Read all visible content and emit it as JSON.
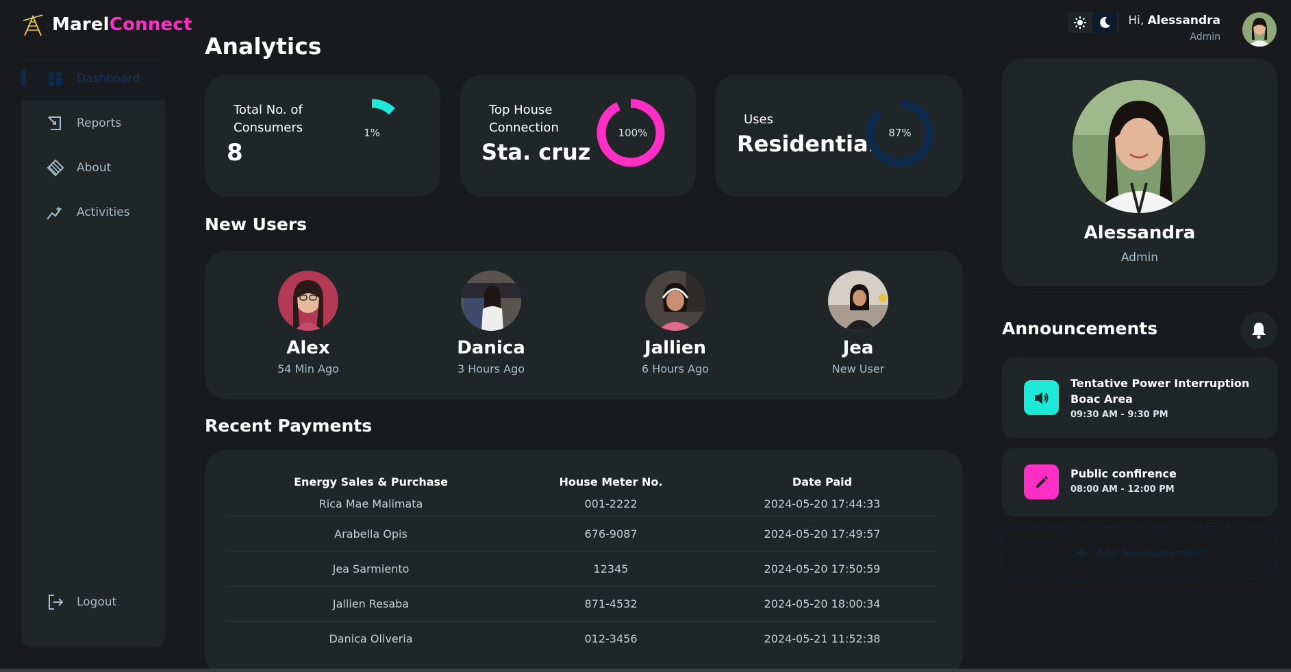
{
  "brand": {
    "name_part1": "Marel",
    "name_part2": "Connect"
  },
  "sidebar": {
    "items": [
      {
        "label": "Dashboard",
        "icon": "grid-icon",
        "active": true
      },
      {
        "label": "Reports",
        "icon": "report-icon",
        "active": false
      },
      {
        "label": "About",
        "icon": "diamond-icon",
        "active": false
      },
      {
        "label": "Activities",
        "icon": "activity-icon",
        "active": false
      }
    ],
    "logout_label": "Logout"
  },
  "header": {
    "greeting_prefix": "Hi,",
    "user_name": "Alessandra",
    "user_role": "Admin"
  },
  "page_title": "Analytics",
  "stats": [
    {
      "label_line1": "Total No. of",
      "label_line2": "Consumers",
      "value": "8",
      "percent_text": "1%",
      "percent": 1,
      "color": "#1de9d8"
    },
    {
      "label_line1": "Top House",
      "label_line2": "Connection",
      "value": "Sta. cruz",
      "percent_text": "100%",
      "percent": 100,
      "color": "#ff2ec4"
    },
    {
      "label_line1": "Uses",
      "label_line2": "",
      "value": "Residential",
      "percent_text": "87%",
      "percent": 87,
      "color": "#0d2a4a"
    }
  ],
  "new_users_title": "New Users",
  "new_users": [
    {
      "name": "Alex",
      "time": "54 Min Ago"
    },
    {
      "name": "Danica",
      "time": "3 Hours Ago"
    },
    {
      "name": "Jallien",
      "time": "6 Hours Ago"
    },
    {
      "name": "Jea",
      "time": "New User"
    }
  ],
  "payments_title": "Recent Payments",
  "payments": {
    "headers": [
      "Energy Sales & Purchase",
      "House Meter No.",
      "Date Paid"
    ],
    "rows": [
      [
        "Rica Mae Malimata",
        "001-2222",
        "2024-05-20 17:44:33"
      ],
      [
        "Arabella Opis",
        "676-9087",
        "2024-05-20 17:49:57"
      ],
      [
        "Jea Sarmiento",
        "12345",
        "2024-05-20 17:50:59"
      ],
      [
        "Jallien Resaba",
        "871-4532",
        "2024-05-20 18:00:34"
      ],
      [
        "Danica Oliveria",
        "012-3456",
        "2024-05-21 11:52:38"
      ]
    ]
  },
  "profile": {
    "name": "Alessandra",
    "role": "Admin"
  },
  "announcements": {
    "title": "Announcements",
    "items": [
      {
        "title": "Tentative Power Interruption Boac Area",
        "time": "09:30 AM - 9:30 PM",
        "icon": "speaker-icon",
        "color": "#1de9d8"
      },
      {
        "title": "Public confirence",
        "time": "08:00 AM - 12:00 PM",
        "icon": "pencil-icon",
        "color": "#ff2ec4"
      }
    ],
    "add_label": "Add Announcement"
  }
}
